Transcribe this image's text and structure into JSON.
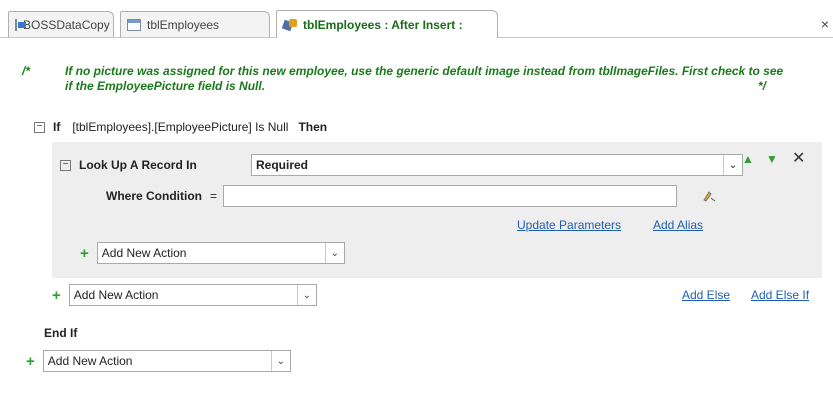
{
  "tabs": [
    {
      "label": "BOSSDataCopy",
      "icon": "form-icon"
    },
    {
      "label": "tblEmployees",
      "icon": "table-icon"
    },
    {
      "label": "tblEmployees : After Insert :",
      "icon": "data-macro-icon"
    }
  ],
  "close_symbol": "×",
  "comment": {
    "open": "/*",
    "text": "If no picture was assigned for this new employee, use the generic default image instead from tblImageFiles. First check to see if the EmployeePicture field is Null.",
    "close": "*/"
  },
  "if_block": {
    "toggle": "−",
    "if_kw": "If",
    "condition": "[tblEmployees].[EmployeePicture] Is Null",
    "then_kw": "Then",
    "end_if": "End If"
  },
  "lookup": {
    "toggle": "−",
    "label": "Look Up A Record In",
    "value": "Required",
    "where_label": "Where Condition",
    "where_eq": "=",
    "where_value": "",
    "update_params": "Update Parameters",
    "add_alias": "Add Alias",
    "move_up": "▲",
    "move_down": "▼",
    "delete": "✕"
  },
  "add_action": {
    "plus": "+",
    "label": "Add New Action",
    "arrow": "⌄"
  },
  "add_else": "Add Else",
  "add_else_if": "Add Else If",
  "colors": {
    "comment_green": "#1b7a1b",
    "link_blue": "#1f5fb0",
    "block_gray": "#eeeeee"
  }
}
